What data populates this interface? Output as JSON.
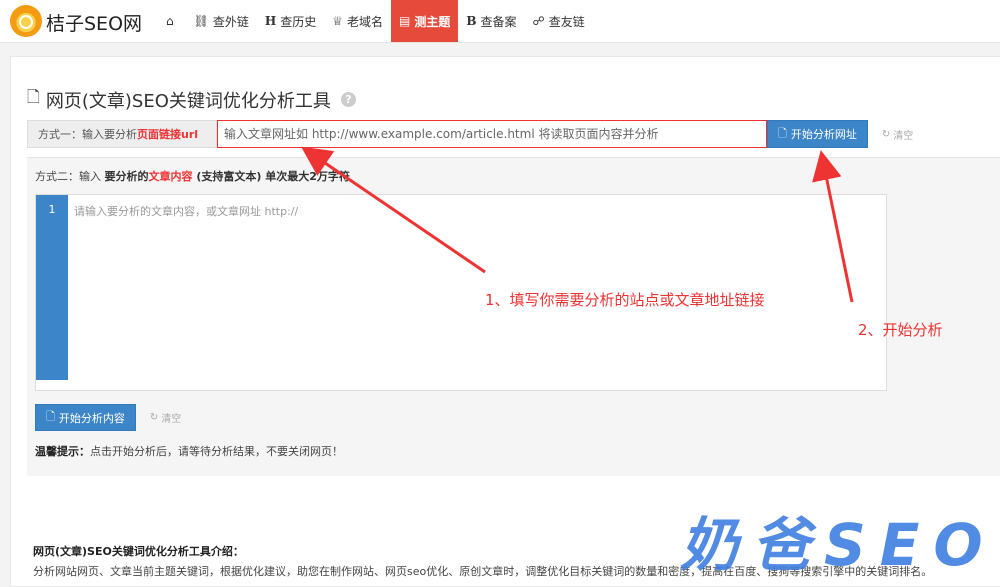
{
  "site": {
    "name": "桔子SEO网",
    "logo_icon": "orange-logo-icon"
  },
  "nav": {
    "items": [
      {
        "label": "",
        "icon": "home-icon",
        "glyph": "⌂"
      },
      {
        "label": "查外链",
        "icon": "link-icon",
        "glyph": "⛓"
      },
      {
        "label": "查历史",
        "icon": "h-icon",
        "glyph": "H"
      },
      {
        "label": "老域名",
        "icon": "trophy-icon",
        "glyph": "♕"
      },
      {
        "label": "测主题",
        "icon": "document-icon",
        "glyph": "🗎",
        "active": true
      },
      {
        "label": "查备案",
        "icon": "b-icon",
        "glyph": "B"
      },
      {
        "label": "查友链",
        "icon": "users-icon",
        "glyph": "👥"
      }
    ]
  },
  "tool": {
    "title": "网页(文章)SEO关键词优化分析工具",
    "help": "?",
    "method1": {
      "label_prefix": "方式一：输入要分析",
      "label_red": "页面链接url",
      "placeholder": "输入文章网址如 http://www.example.com/article.html 将读取页面内容并分析",
      "button": "开始分析网址",
      "clear": "清空"
    },
    "method2": {
      "label_prefix": "方式二：输入 ",
      "label_bold": "要分析的",
      "label_red": "文章内容",
      "label_suffix": " (支持富文本) 单次最大2万字符",
      "line_number": "1",
      "editor_placeholder": "请输入要分析的文章内容，或文章网址 http://",
      "button": "开始分析内容",
      "clear": "清空"
    },
    "tip_label": "温馨提示：",
    "tip_text": "点击开始分析后，请等待分析结果，不要关闭网页！"
  },
  "annotations": {
    "note1": "1、填写你需要分析的站点或文章地址链接",
    "note2": "2、开始分析",
    "color": "#e33333"
  },
  "intro": {
    "title": "网页(文章)SEO关键词优化分析工具介绍：",
    "body": "分析网站网页、文章当前主题关键词，根据优化建议，助您在制作网站、网页seo优化、原创文章时，调整优化目标关键词的数量和密度，提高在百度、搜狗等搜索引擎中的关键词排名。"
  },
  "watermark": "奶爸SEO",
  "colors": {
    "accent": "#3c85c8",
    "active_nav": "#e64a3b",
    "warning": "#e33333"
  }
}
